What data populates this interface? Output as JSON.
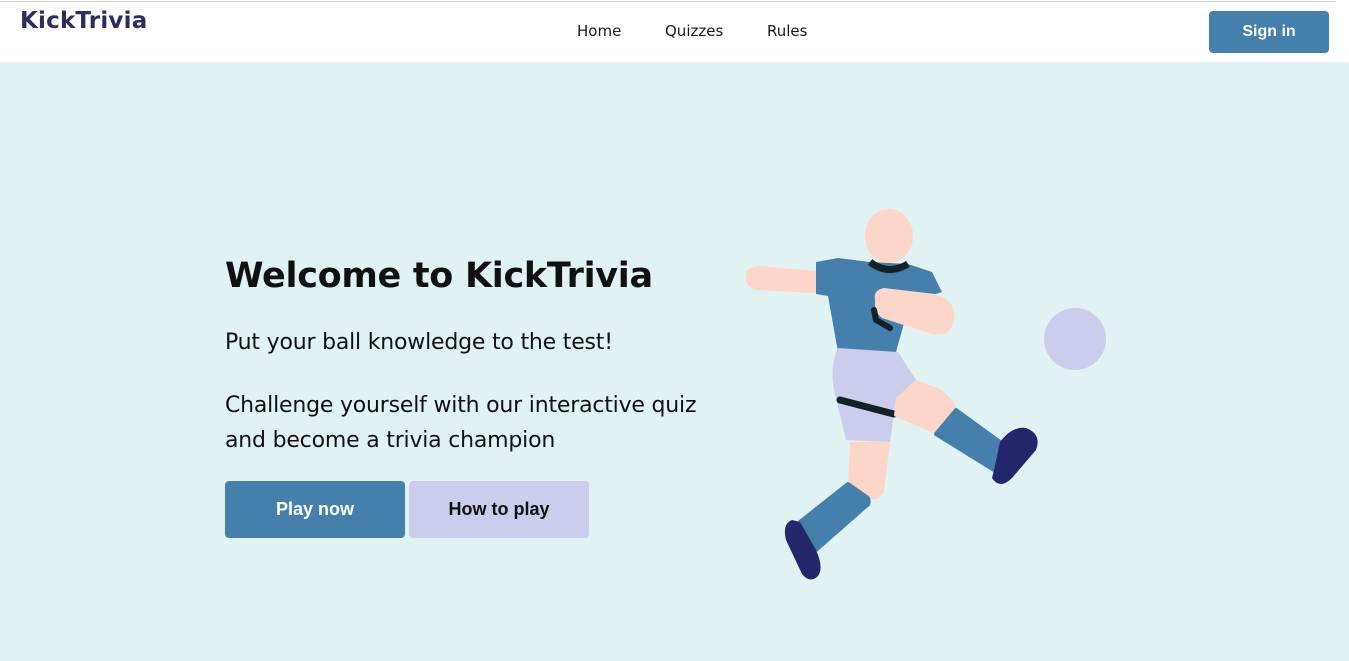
{
  "header": {
    "logo": "KickTrivia",
    "nav": [
      "Home",
      "Quizzes",
      "Rules"
    ],
    "signin_label": "Sign in"
  },
  "hero": {
    "title": "Welcome to KickTrivia",
    "tagline": "Put your ball knowledge to the test!",
    "description": "Challenge yourself with our interactive quiz and become a trivia champion",
    "play_label": "Play now",
    "how_label": "How to play"
  },
  "illustration": {
    "name": "football-player-kicking-ball-illustration"
  },
  "colors": {
    "primary": "#4580ad",
    "secondary": "#ccccec",
    "hero_bg": "#e0f2f1",
    "logo": "#2b2d5e",
    "skin": "#fdd6ca",
    "boots": "#24276b",
    "ball": "#ccccec"
  }
}
